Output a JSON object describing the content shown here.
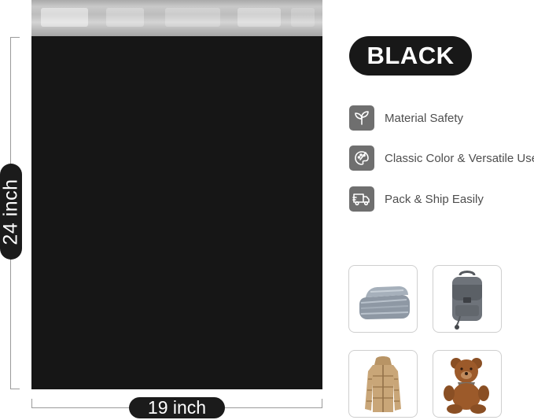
{
  "product": {
    "color_name": "BLACK",
    "height_label": "24 inch",
    "width_label": "19 inch"
  },
  "features": [
    {
      "icon": "sprout-icon",
      "label": "Material Safety"
    },
    {
      "icon": "palette-icon",
      "label": "Classic Color & Versatile Use"
    },
    {
      "icon": "truck-icon",
      "label": "Pack & Ship Easily"
    }
  ],
  "use_cases": [
    {
      "icon": "blanket-icon"
    },
    {
      "icon": "backpack-icon"
    },
    {
      "icon": "puffer-jacket-icon"
    },
    {
      "icon": "teddy-bear-icon"
    }
  ],
  "colors": {
    "bag": "#161616",
    "seal_strip": "#bdbdbd",
    "pill": "#1b1b1b",
    "icon_bg": "#6f6f6f",
    "feature_text": "#4e4e4e"
  }
}
